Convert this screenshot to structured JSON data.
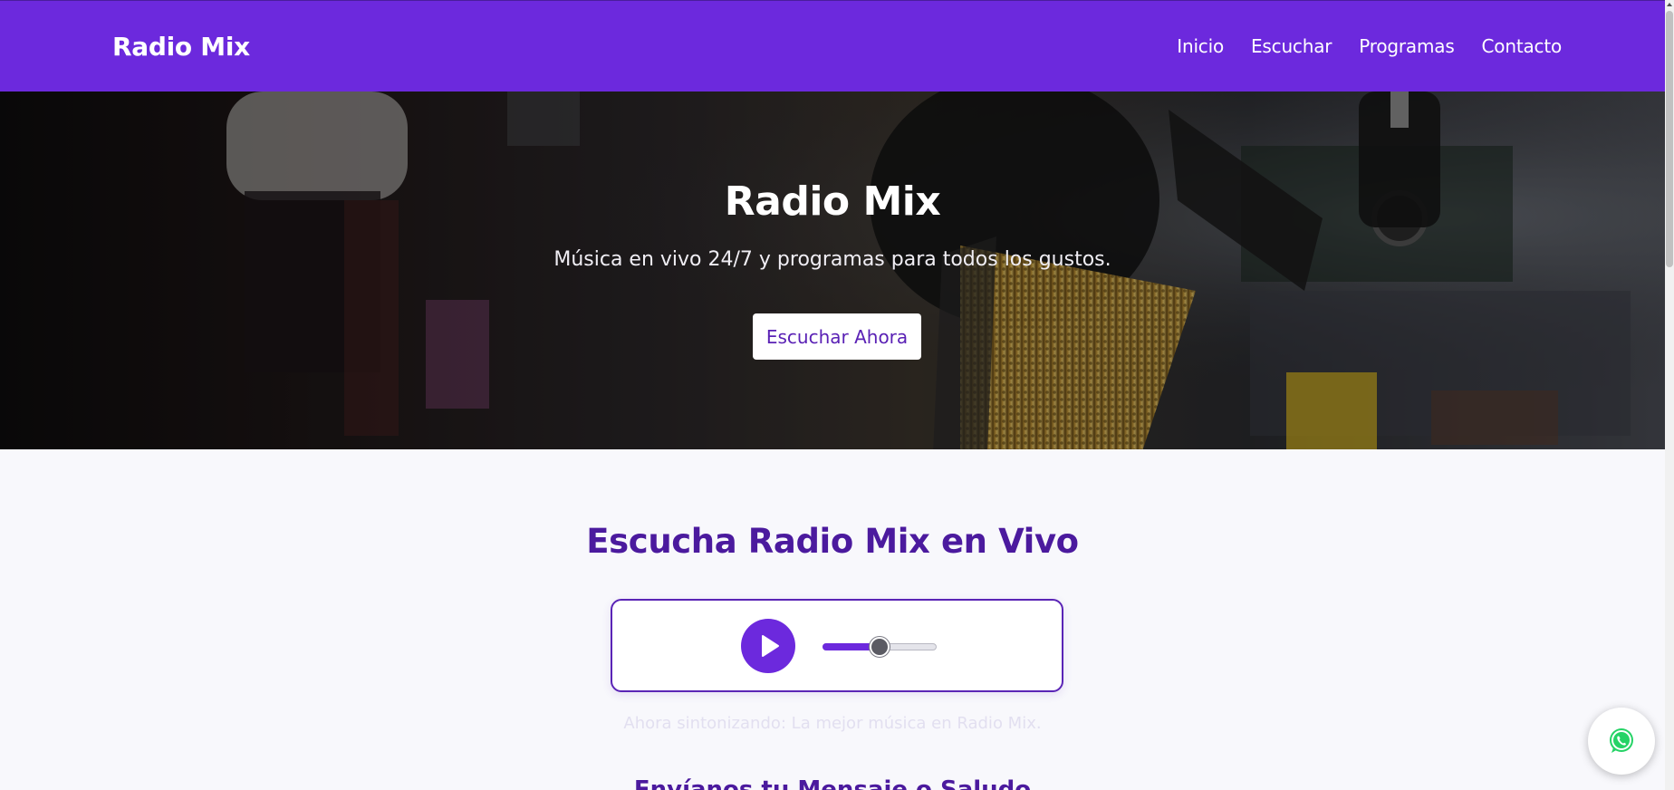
{
  "navbar": {
    "brand": "Radio Mix",
    "links": [
      "Inicio",
      "Escuchar",
      "Programas",
      "Contacto"
    ]
  },
  "hero": {
    "title": "Radio Mix",
    "subtitle": "Música en vivo 24/7 y programas para todos los gustos.",
    "button_label": "Escuchar Ahora"
  },
  "listen": {
    "title": "Escucha Radio Mix en Vivo",
    "volume_level": 0.5,
    "now_playing": "Ahora sintonizando: La mejor música en Radio Mix."
  },
  "message_section": {
    "title": "Envíanos tu Mensaje o Saludo"
  },
  "icons": {
    "play": "play-icon",
    "whatsapp": "whatsapp-icon"
  },
  "colors": {
    "primary": "#6c29dd",
    "heading": "#4b1a9e",
    "whatsapp_green": "#25d366"
  }
}
